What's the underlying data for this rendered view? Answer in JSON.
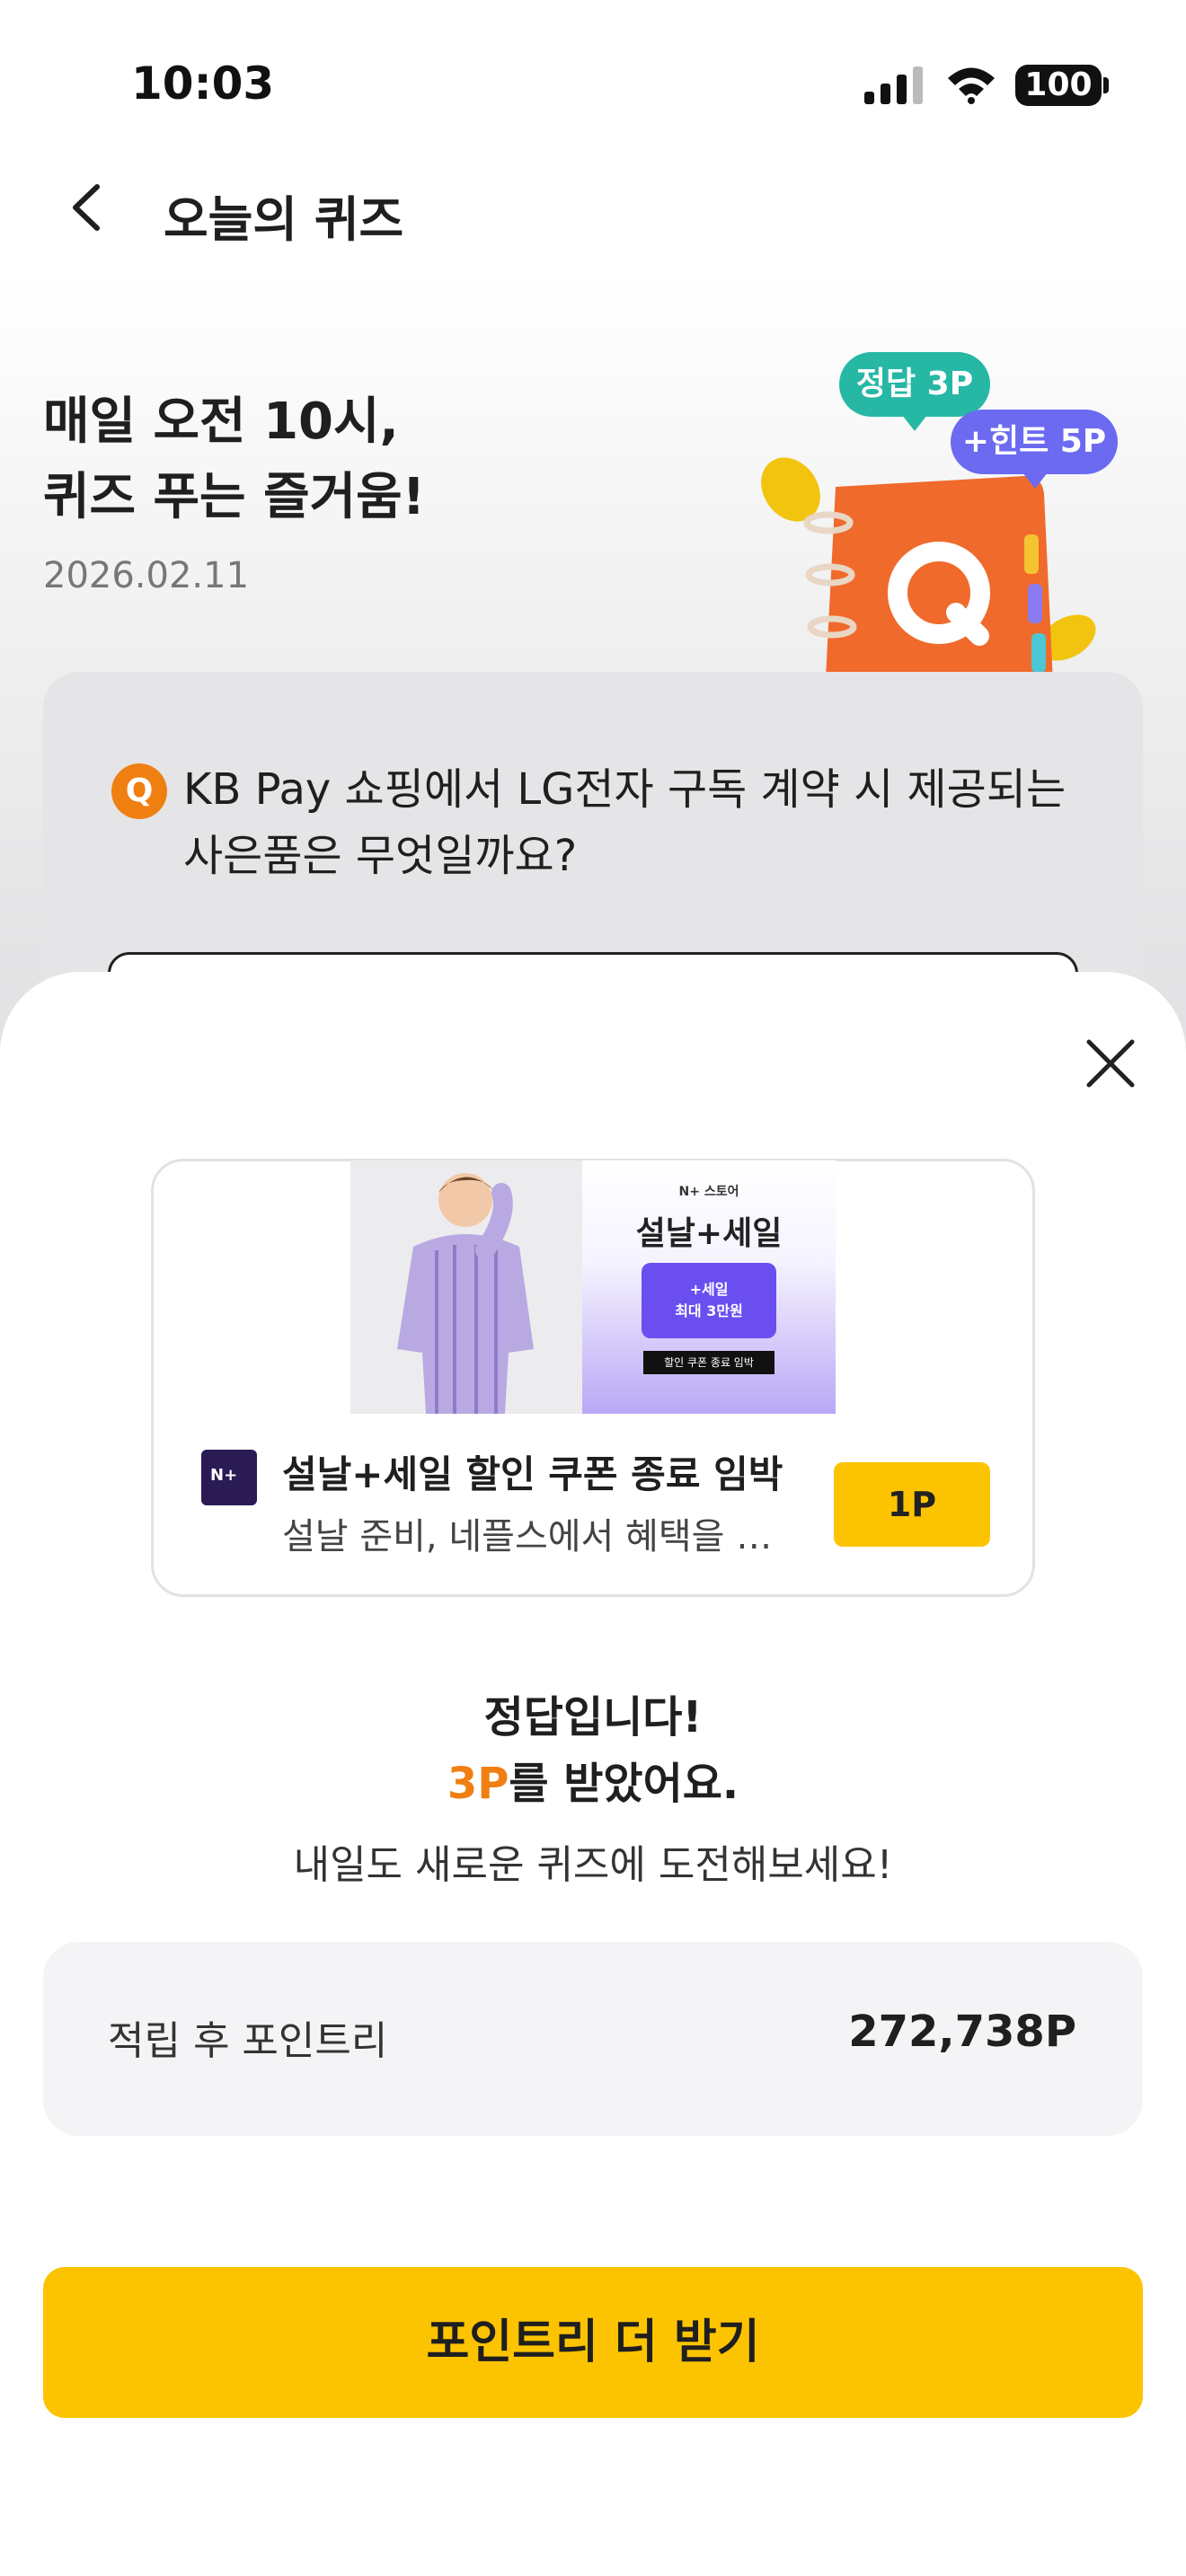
{
  "status_bar": {
    "time": "10:03",
    "battery": "100"
  },
  "header": {
    "title": "오늘의 퀴즈"
  },
  "hero": {
    "title_line1": "매일 오전 10시,",
    "title_line2": "퀴즈 푸는 즐거움!",
    "date": "2026.02.11",
    "bubble_answer": "정답 3P",
    "bubble_hint": "+힌트 5P",
    "notebook_letter": "Q"
  },
  "quiz": {
    "badge": "Q",
    "question_line1": "KB Pay 쇼핑에서 LG전자 구독 계약 시 제공되는",
    "question_line2": "사은품은 무엇일까요?"
  },
  "ad": {
    "banner_store": "N+ 스토어",
    "banner_title": "설날+세일",
    "banner_coupon_line1": "+세일",
    "banner_coupon_line2": "최대 3만원",
    "banner_bar": "할인 쿠폰 종료 임박",
    "logo_text": "N+",
    "title": "설날+세일 할인 쿠폰 종료 임박",
    "description": "설날 준비, 네플스에서 혜택을 더...",
    "point_button": "1P"
  },
  "result": {
    "line1": "정답입니다!",
    "points_earned": "3P",
    "line2_suffix": "를 받았어요.",
    "subtitle": "내일도 새로운 퀴즈에 도전해보세요!"
  },
  "point_summary": {
    "label": "적립 후 포인트리",
    "value": "272,738P"
  },
  "cta": {
    "label": "포인트리 더 받기"
  },
  "colors": {
    "accent_yellow": "#FCC400",
    "accent_orange": "#F07F12",
    "bubble_green": "#27B7A5",
    "bubble_purple": "#6B6AF0"
  }
}
